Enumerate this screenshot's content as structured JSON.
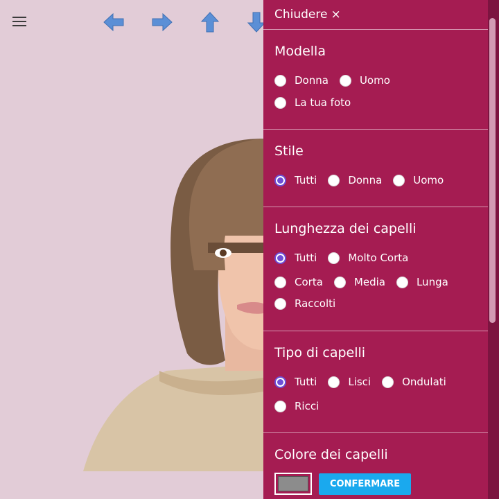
{
  "toolbar": {
    "menu_icon": "hamburger-menu-icon",
    "arrows": [
      "arrow-left-icon",
      "arrow-right-icon",
      "arrow-up-icon",
      "arrow-down-icon"
    ],
    "arrow_color": "#5b8fd6"
  },
  "panel": {
    "close_label": "Chiudere",
    "close_symbol": "×",
    "background": "#a51c52",
    "sections": {
      "modella": {
        "title": "Modella",
        "options": [
          "Donna",
          "Uomo",
          "La tua foto"
        ],
        "selected": null
      },
      "stile": {
        "title": "Stile",
        "options": [
          "Tutti",
          "Donna",
          "Uomo"
        ],
        "selected": "Tutti"
      },
      "lunghezza": {
        "title": "Lunghezza dei capelli",
        "options": [
          "Tutti",
          "Molto Corta",
          "Corta",
          "Media",
          "Lunga",
          "Raccolti"
        ],
        "selected": "Tutti"
      },
      "tipo": {
        "title": "Tipo di capelli",
        "options": [
          "Tutti",
          "Lisci",
          "Ondulati",
          "Ricci"
        ],
        "selected": "Tutti"
      },
      "colore": {
        "title": "Colore dei capelli",
        "swatch_color": "#8c8c8c",
        "confirm_label": "CONFERMARE",
        "confirm_color": "#1aa9ee"
      }
    }
  }
}
